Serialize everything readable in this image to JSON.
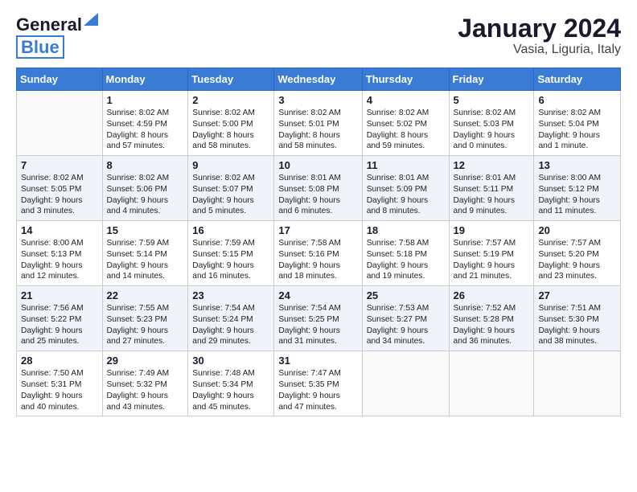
{
  "header": {
    "logo_line1": "General",
    "logo_line2": "Blue",
    "title": "January 2024",
    "subtitle": "Vasia, Liguria, Italy"
  },
  "calendar": {
    "days_of_week": [
      "Sunday",
      "Monday",
      "Tuesday",
      "Wednesday",
      "Thursday",
      "Friday",
      "Saturday"
    ],
    "weeks": [
      [
        {
          "day": "",
          "info": ""
        },
        {
          "day": "1",
          "info": "Sunrise: 8:02 AM\nSunset: 4:59 PM\nDaylight: 8 hours\nand 57 minutes."
        },
        {
          "day": "2",
          "info": "Sunrise: 8:02 AM\nSunset: 5:00 PM\nDaylight: 8 hours\nand 58 minutes."
        },
        {
          "day": "3",
          "info": "Sunrise: 8:02 AM\nSunset: 5:01 PM\nDaylight: 8 hours\nand 58 minutes."
        },
        {
          "day": "4",
          "info": "Sunrise: 8:02 AM\nSunset: 5:02 PM\nDaylight: 8 hours\nand 59 minutes."
        },
        {
          "day": "5",
          "info": "Sunrise: 8:02 AM\nSunset: 5:03 PM\nDaylight: 9 hours\nand 0 minutes."
        },
        {
          "day": "6",
          "info": "Sunrise: 8:02 AM\nSunset: 5:04 PM\nDaylight: 9 hours\nand 1 minute."
        }
      ],
      [
        {
          "day": "7",
          "info": "Sunrise: 8:02 AM\nSunset: 5:05 PM\nDaylight: 9 hours\nand 3 minutes."
        },
        {
          "day": "8",
          "info": "Sunrise: 8:02 AM\nSunset: 5:06 PM\nDaylight: 9 hours\nand 4 minutes."
        },
        {
          "day": "9",
          "info": "Sunrise: 8:02 AM\nSunset: 5:07 PM\nDaylight: 9 hours\nand 5 minutes."
        },
        {
          "day": "10",
          "info": "Sunrise: 8:01 AM\nSunset: 5:08 PM\nDaylight: 9 hours\nand 6 minutes."
        },
        {
          "day": "11",
          "info": "Sunrise: 8:01 AM\nSunset: 5:09 PM\nDaylight: 9 hours\nand 8 minutes."
        },
        {
          "day": "12",
          "info": "Sunrise: 8:01 AM\nSunset: 5:11 PM\nDaylight: 9 hours\nand 9 minutes."
        },
        {
          "day": "13",
          "info": "Sunrise: 8:00 AM\nSunset: 5:12 PM\nDaylight: 9 hours\nand 11 minutes."
        }
      ],
      [
        {
          "day": "14",
          "info": "Sunrise: 8:00 AM\nSunset: 5:13 PM\nDaylight: 9 hours\nand 12 minutes."
        },
        {
          "day": "15",
          "info": "Sunrise: 7:59 AM\nSunset: 5:14 PM\nDaylight: 9 hours\nand 14 minutes."
        },
        {
          "day": "16",
          "info": "Sunrise: 7:59 AM\nSunset: 5:15 PM\nDaylight: 9 hours\nand 16 minutes."
        },
        {
          "day": "17",
          "info": "Sunrise: 7:58 AM\nSunset: 5:16 PM\nDaylight: 9 hours\nand 18 minutes."
        },
        {
          "day": "18",
          "info": "Sunrise: 7:58 AM\nSunset: 5:18 PM\nDaylight: 9 hours\nand 19 minutes."
        },
        {
          "day": "19",
          "info": "Sunrise: 7:57 AM\nSunset: 5:19 PM\nDaylight: 9 hours\nand 21 minutes."
        },
        {
          "day": "20",
          "info": "Sunrise: 7:57 AM\nSunset: 5:20 PM\nDaylight: 9 hours\nand 23 minutes."
        }
      ],
      [
        {
          "day": "21",
          "info": "Sunrise: 7:56 AM\nSunset: 5:22 PM\nDaylight: 9 hours\nand 25 minutes."
        },
        {
          "day": "22",
          "info": "Sunrise: 7:55 AM\nSunset: 5:23 PM\nDaylight: 9 hours\nand 27 minutes."
        },
        {
          "day": "23",
          "info": "Sunrise: 7:54 AM\nSunset: 5:24 PM\nDaylight: 9 hours\nand 29 minutes."
        },
        {
          "day": "24",
          "info": "Sunrise: 7:54 AM\nSunset: 5:25 PM\nDaylight: 9 hours\nand 31 minutes."
        },
        {
          "day": "25",
          "info": "Sunrise: 7:53 AM\nSunset: 5:27 PM\nDaylight: 9 hours\nand 34 minutes."
        },
        {
          "day": "26",
          "info": "Sunrise: 7:52 AM\nSunset: 5:28 PM\nDaylight: 9 hours\nand 36 minutes."
        },
        {
          "day": "27",
          "info": "Sunrise: 7:51 AM\nSunset: 5:30 PM\nDaylight: 9 hours\nand 38 minutes."
        }
      ],
      [
        {
          "day": "28",
          "info": "Sunrise: 7:50 AM\nSunset: 5:31 PM\nDaylight: 9 hours\nand 40 minutes."
        },
        {
          "day": "29",
          "info": "Sunrise: 7:49 AM\nSunset: 5:32 PM\nDaylight: 9 hours\nand 43 minutes."
        },
        {
          "day": "30",
          "info": "Sunrise: 7:48 AM\nSunset: 5:34 PM\nDaylight: 9 hours\nand 45 minutes."
        },
        {
          "day": "31",
          "info": "Sunrise: 7:47 AM\nSunset: 5:35 PM\nDaylight: 9 hours\nand 47 minutes."
        },
        {
          "day": "",
          "info": ""
        },
        {
          "day": "",
          "info": ""
        },
        {
          "day": "",
          "info": ""
        }
      ]
    ]
  }
}
